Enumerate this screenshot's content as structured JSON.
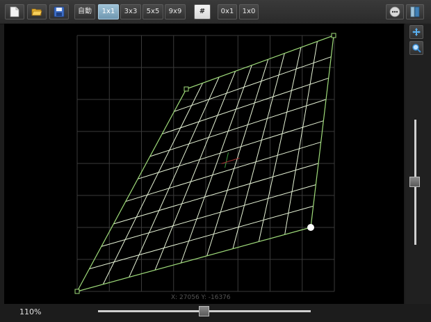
{
  "toolbar": {
    "new_icon": "document-new-icon",
    "open_icon": "folder-open-icon",
    "save_icon": "floppy-save-icon",
    "auto_label": "自動",
    "grid_options": [
      "1x1",
      "3x3",
      "5x5",
      "9x9"
    ],
    "selected_grid": "1x1",
    "hash_label": "#",
    "subdiv_options": [
      "0x1",
      "1x0"
    ],
    "more_icon": "more-options-icon",
    "panel_icon": "panel-toggle-icon"
  },
  "side": {
    "move_icon": "move-arrows-icon",
    "zoom_icon": "magnifier-icon"
  },
  "status": {
    "zoom": "110%",
    "coords": "X: 27056  Y: -16376"
  },
  "colors": {
    "mesh": "#e8f5d8",
    "mesh_edge": "#9fdc7a",
    "guide_grid": "#3a3a3a",
    "accent": "#6f97b0"
  }
}
